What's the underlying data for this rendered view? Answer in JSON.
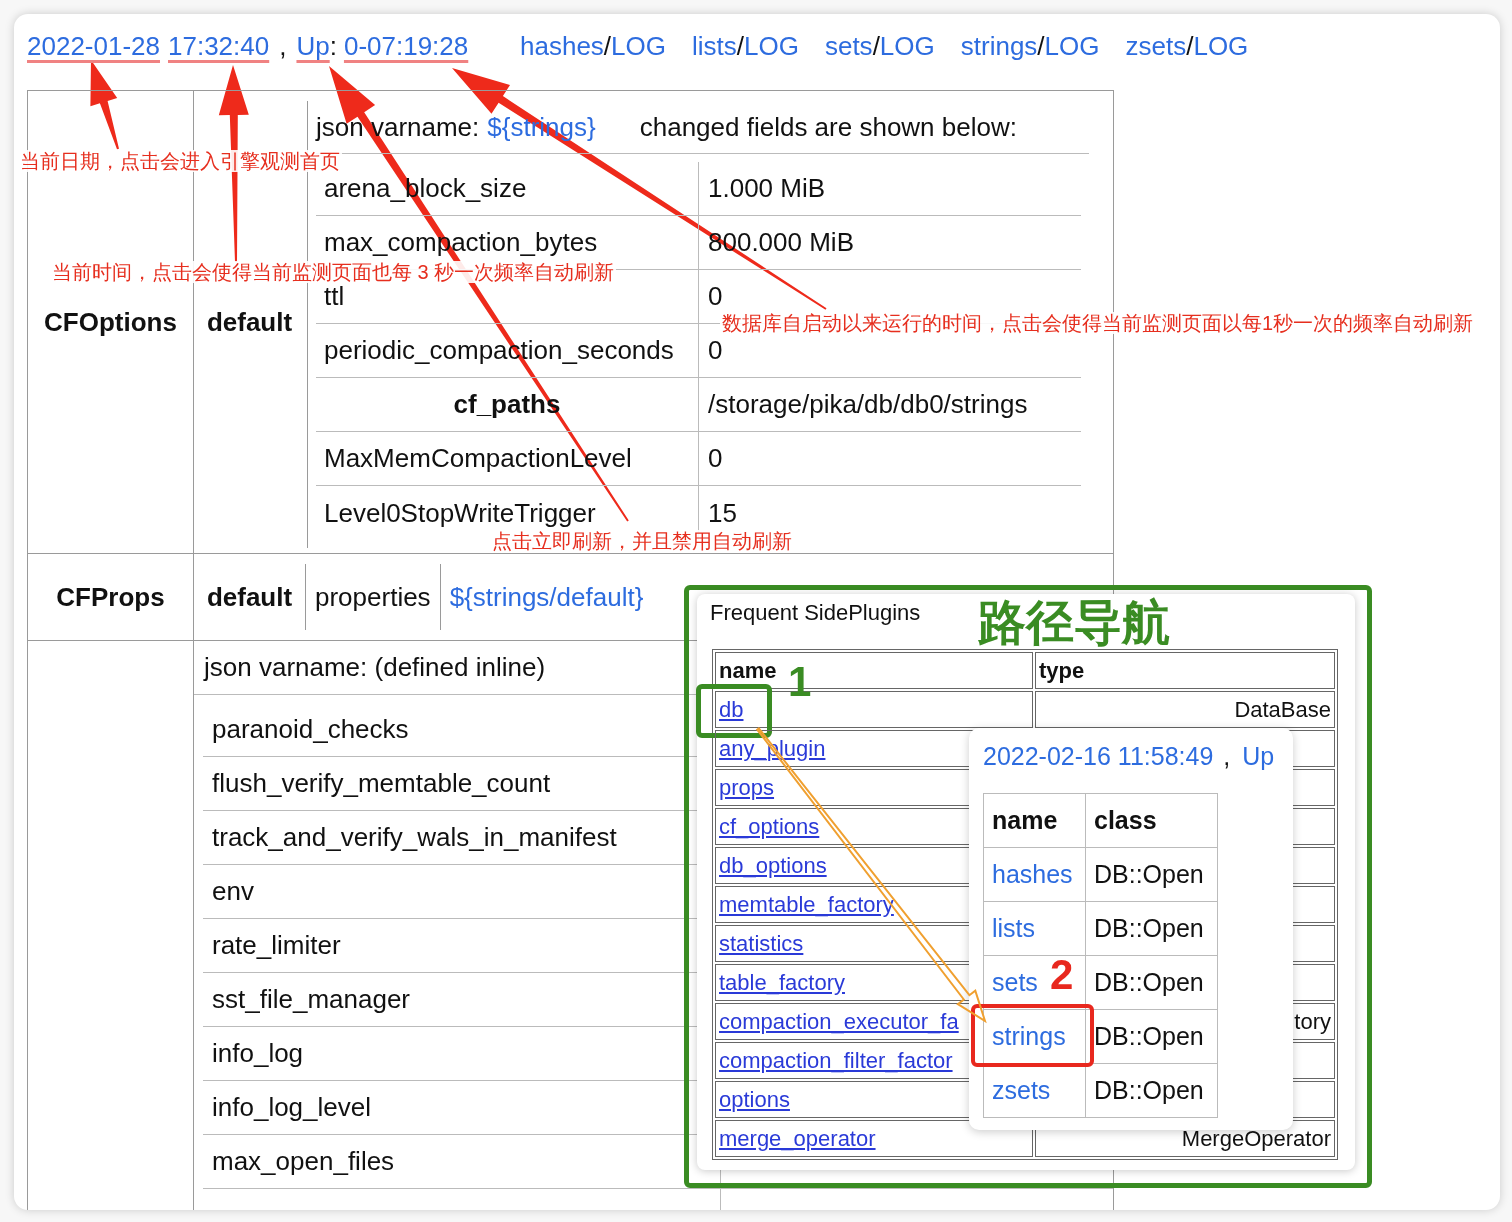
{
  "header": {
    "date": {
      "text": "2022-01-28",
      "underlined": true
    },
    "time": {
      "text": "17:32:40",
      "underlined": true
    },
    "separator": ",",
    "up": {
      "text": "Up",
      "underlined": true
    },
    "colon": ":",
    "uptime": {
      "text": "0-07:19:28",
      "underlined": true
    },
    "log_links": [
      {
        "name": "hashes",
        "slash": "/",
        "file": "LOG"
      },
      {
        "name": "lists",
        "slash": "/",
        "file": "LOG"
      },
      {
        "name": "sets",
        "slash": "/",
        "file": "LOG"
      },
      {
        "name": "strings",
        "slash": "/",
        "file": "LOG"
      },
      {
        "name": "zsets",
        "slash": "/",
        "file": "LOG"
      }
    ]
  },
  "sections": [
    {
      "kind": "options",
      "name": "CFOptions",
      "instance": "default",
      "varname_label": "json varname:",
      "varname": "${strings}",
      "note": "changed fields are shown below:",
      "fields": [
        {
          "kind": "field",
          "key": "arena_block_size",
          "value": "1.000 MiB"
        },
        {
          "kind": "field",
          "key": "max_compaction_bytes",
          "value": "800.000 MiB"
        },
        {
          "kind": "field",
          "key": "ttl",
          "value": "0"
        },
        {
          "kind": "field",
          "key": "periodic_compaction_seconds",
          "value": "0"
        },
        {
          "kind": "group",
          "key": "cf_paths",
          "value": "/storage/pika/db/db0/strings"
        },
        {
          "kind": "field",
          "key": "MaxMemCompactionLevel",
          "value": "0"
        },
        {
          "kind": "field",
          "key": "Level0StopWriteTrigger",
          "value": "15"
        }
      ]
    },
    {
      "kind": "props",
      "name": "CFProps",
      "instance": "default",
      "label": "properties",
      "link": "${strings/default}"
    },
    {
      "kind": "inline",
      "varname": "json varname: (defined inline)",
      "fields": [
        {
          "key": "paranoid_checks"
        },
        {
          "key": "flush_verify_memtable_count"
        },
        {
          "key": "track_and_verify_wals_in_manifest"
        },
        {
          "key": "env"
        },
        {
          "key": "rate_limiter"
        },
        {
          "key": "sst_file_manager"
        },
        {
          "key": "info_log"
        },
        {
          "key": "info_log_level"
        },
        {
          "key": "max_open_files"
        }
      ]
    }
  ],
  "plugins_panel": {
    "title": "Frequent SidePlugins",
    "columns": [
      "name",
      "type"
    ],
    "rows": [
      {
        "name": "db",
        "type": "DataBase",
        "highlighted": true
      },
      {
        "name": "any_plugin",
        "highlighted": false
      },
      {
        "name": "props",
        "highlighted": false
      },
      {
        "name": "cf_options",
        "highlighted": false
      },
      {
        "name": "db_options",
        "highlighted": false
      },
      {
        "name": "memtable_factory",
        "highlighted": false
      },
      {
        "name": "statistics",
        "highlighted": false
      },
      {
        "name": "table_factory",
        "highlighted": false
      },
      {
        "name": "compaction_executor_fa",
        "type": "tory",
        "highlighted": false
      },
      {
        "name": "compaction_filter_factor",
        "highlighted": false
      },
      {
        "name": "options",
        "highlighted": false
      },
      {
        "name": "merge_operator",
        "type": "MergeOperator",
        "highlighted": false
      }
    ]
  },
  "db_popup": {
    "date": "2022-02-16 11:58:49",
    "separator": ",",
    "up": "Up",
    "columns": [
      "name",
      "class"
    ],
    "rows": [
      {
        "name": "hashes",
        "class": "DB::Open",
        "highlighted": false
      },
      {
        "name": "lists",
        "class": "DB::Open",
        "highlighted": false
      },
      {
        "name": "sets",
        "class": "DB::Open",
        "highlighted": false
      },
      {
        "name": "strings",
        "class": "DB::Open",
        "highlighted": true
      },
      {
        "name": "zsets",
        "class": "DB::Open",
        "highlighted": false
      }
    ]
  },
  "annotations": {
    "notes": [
      "当前日期，点击会进入引擎观测首页",
      "当前时间，点击会使得当前监测页面也每 3 秒一次频率自动刷新",
      "数据库自启动以来运行的时间，点击会使得当前监测页面以每1秒一次的频率自动刷新",
      "点击立即刷新，并且禁用自动刷新"
    ],
    "title": "路径导航",
    "steps": [
      {
        "text": "1",
        "color": "#3a8c23"
      },
      {
        "text": "2",
        "color": "#e8281e"
      }
    ]
  }
}
